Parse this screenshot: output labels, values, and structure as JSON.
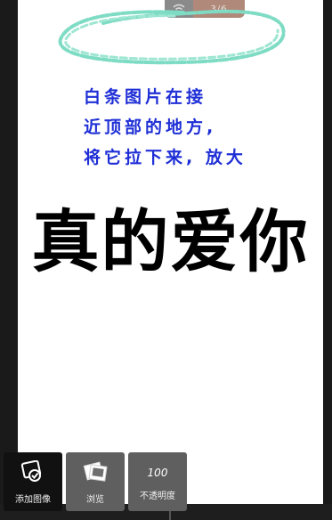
{
  "status": {
    "counter": "3/6"
  },
  "canvas": {
    "instruction_lines": [
      "白条图片在接",
      "近顶部的地方,",
      "将它拉下来, 放大"
    ],
    "big_text": "真的爱你"
  },
  "toolbar": {
    "add_image_label": "添加图像",
    "browse_label": "浏览",
    "opacity_value": "100",
    "opacity_label": "不透明度"
  },
  "colors": {
    "instruction_text": "#1f2fd6",
    "scribble": "#7fdcc4",
    "toolbar_button": "#5f5f5f",
    "toolbar_active": "#111111"
  }
}
